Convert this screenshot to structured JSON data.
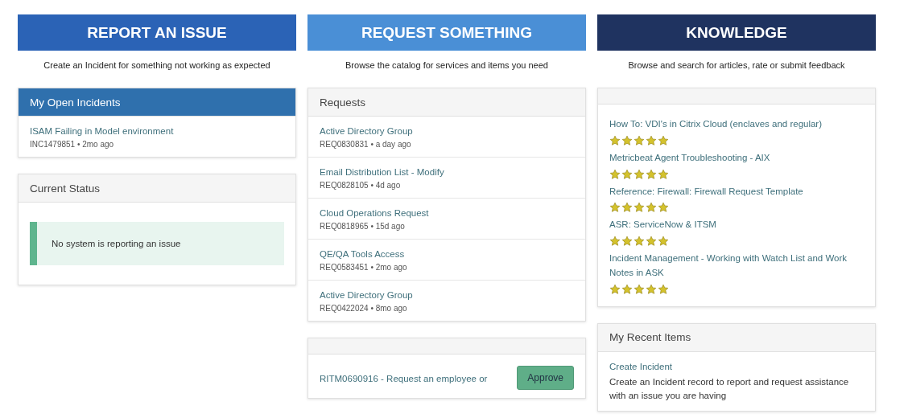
{
  "columns": [
    {
      "banner": {
        "title": "REPORT AN ISSUE",
        "subtitle": "Create an Incident for something not working as expected",
        "color": "#2b63b6"
      },
      "cards": [
        {
          "kind": "list",
          "title": "My Open Incidents",
          "highlighted": true,
          "items": [
            {
              "title": "ISAM Failing in Model environment",
              "meta": "INC1479851 • 2mo ago"
            }
          ]
        },
        {
          "kind": "status",
          "title": "Current Status",
          "highlighted": false,
          "message": "No system is reporting an issue"
        }
      ]
    },
    {
      "banner": {
        "title": "REQUEST SOMETHING",
        "subtitle": "Browse the catalog for services and items you need",
        "color": "#4a8fd6"
      },
      "cards": [
        {
          "kind": "list",
          "title": "Requests",
          "highlighted": false,
          "items": [
            {
              "title": "Active Directory Group",
              "meta": "REQ0830831 • a day ago"
            },
            {
              "title": "Email Distribution List - Modify",
              "meta": "REQ0828105 • 4d ago"
            },
            {
              "title": "Cloud Operations Request",
              "meta": "REQ0818965 • 15d ago"
            },
            {
              "title": "QE/QA Tools Access",
              "meta": "REQ0583451 • 2mo ago"
            },
            {
              "title": "Active Directory Group",
              "meta": "REQ0422024 • 8mo ago"
            }
          ]
        },
        {
          "kind": "approvals",
          "items": [
            {
              "title": "RITM0690916 - Request an employee or",
              "action": "Approve"
            }
          ]
        }
      ]
    },
    {
      "banner": {
        "title": "KNOWLEDGE",
        "subtitle": "Browse and search for articles, rate or submit feedback",
        "color": "#1f3360"
      },
      "cards": [
        {
          "kind": "articles",
          "items": [
            {
              "title": "How To: VDI's in Citrix Cloud (enclaves and regular)",
              "stars": 5
            },
            {
              "title": "Metricbeat Agent Troubleshooting - AIX",
              "stars": 5
            },
            {
              "title": "Reference: Firewall: Firewall Request Template",
              "stars": 5
            },
            {
              "title": "ASR: ServiceNow & ITSM",
              "stars": 5
            },
            {
              "title": "Incident Management - Working with Watch List and Work Notes in ASK",
              "stars": 5
            }
          ]
        },
        {
          "kind": "recent",
          "title": "My Recent Items",
          "highlighted": false,
          "items": [
            {
              "title": "Create Incident",
              "description": "Create an Incident record to report and request assistance with an issue you are having"
            }
          ]
        }
      ]
    }
  ]
}
